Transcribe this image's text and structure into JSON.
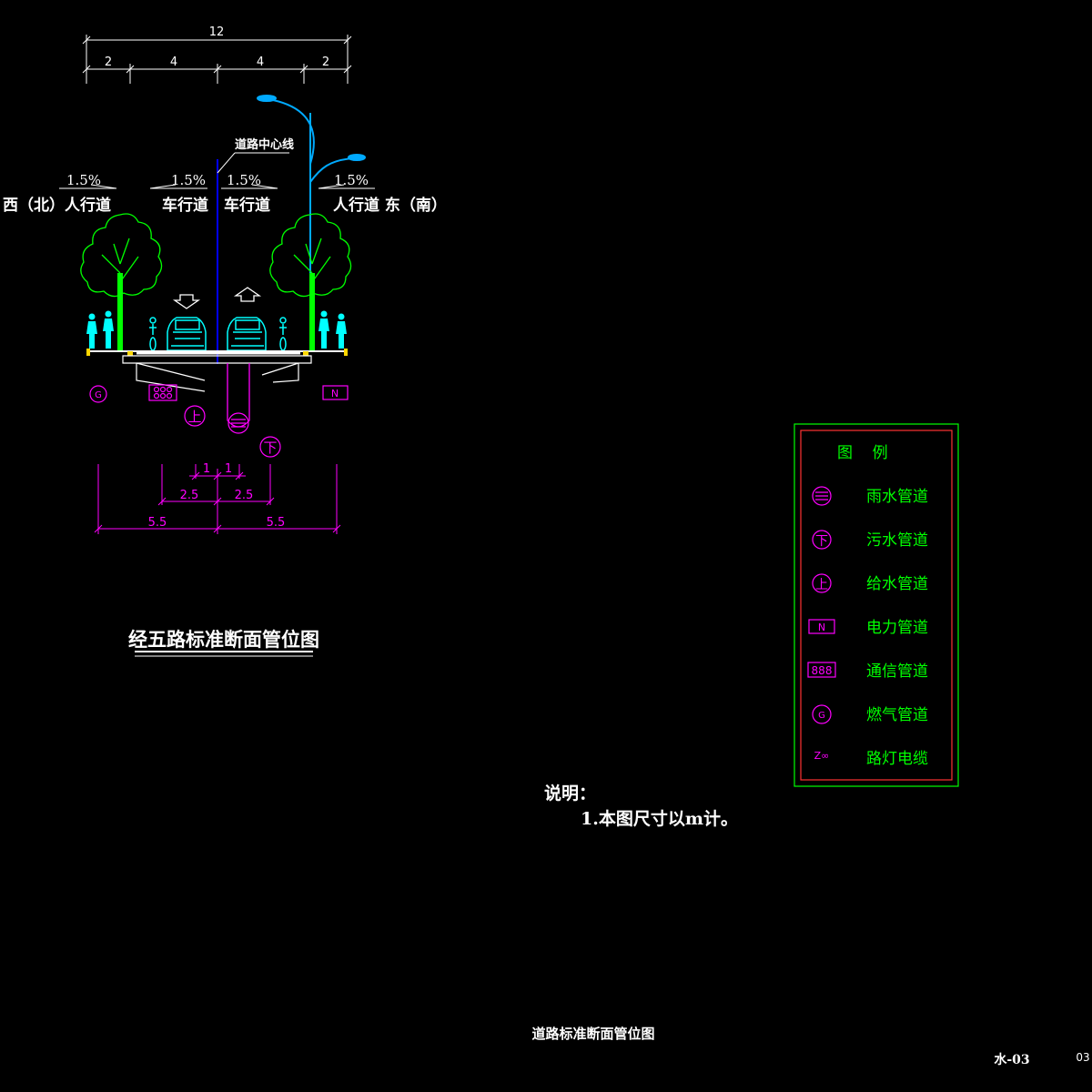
{
  "top_dims": {
    "total": "12",
    "segments": [
      "2",
      "4",
      "4",
      "2"
    ]
  },
  "bottom_dims": {
    "inner": [
      "1",
      "1"
    ],
    "middle": [
      "2.5",
      "2.5"
    ],
    "outer": [
      "5.5",
      "5.5"
    ]
  },
  "labels": {
    "centerline": "道路中心线",
    "slope": "1.5%",
    "west_sidewalk": "西（北）人行道",
    "carriageway": "车行道",
    "east_sidewalk": "人行道 东（南）"
  },
  "pipe_symbols": {
    "gas": "G",
    "power": "N",
    "water": "上",
    "rain": "═",
    "sewer": "下"
  },
  "section_title": "经五路标准断面管位图",
  "notes": {
    "heading": "说明：",
    "items": [
      "1.本图尺寸以m计。"
    ]
  },
  "legend": {
    "title": "图    例",
    "items": [
      {
        "symbol": "≡",
        "label": "雨水管道"
      },
      {
        "symbol": "下",
        "label": "污水管道"
      },
      {
        "symbol": "上",
        "label": "给水管道"
      },
      {
        "symbol": "N",
        "label": "电力管道"
      },
      {
        "symbol": "888",
        "label": "通信管道"
      },
      {
        "symbol": "G",
        "label": "燃气管道"
      },
      {
        "symbol": "Z∞",
        "label": "路灯电缆"
      }
    ]
  },
  "footer": {
    "title": "道路标准断面管位图",
    "drawing_no": "水-03",
    "sheet": "03"
  },
  "colors": {
    "background": "#000000",
    "dims": "#ffffff",
    "pipes": "#ff00ff",
    "legend_text": "#00ff00",
    "trees": "#00ff00",
    "people": "#00ffff",
    "centerline": "#0000ff",
    "legend_outer": "#00ff00",
    "legend_inner": "#ff0000"
  }
}
